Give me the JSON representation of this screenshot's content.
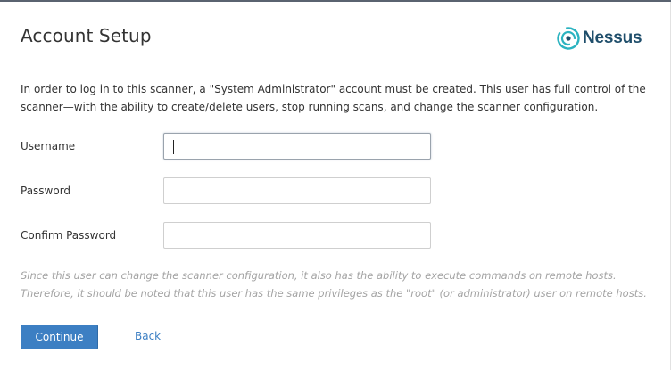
{
  "header": {
    "title": "Account Setup",
    "logo_text": "Nessus",
    "logo_icon": "nessus-logo-icon"
  },
  "intro_text": "In order to log in to this scanner, a \"System Administrator\" account must be created. This user has full control of the scanner—with the ability to create/delete users, stop running scans, and change the scanner configuration.",
  "form": {
    "username": {
      "label": "Username",
      "value": "",
      "focused": true
    },
    "password": {
      "label": "Password",
      "value": ""
    },
    "confirm_password": {
      "label": "Confirm Password",
      "value": ""
    }
  },
  "note_text": "Since this user can change the scanner configuration, it also has the ability to execute commands on remote hosts. Therefore, it should be noted that this user has the same privileges as the \"root\" (or administrator) user on remote hosts.",
  "actions": {
    "continue_label": "Continue",
    "back_label": "Back"
  },
  "colors": {
    "primary": "#3c7fc3",
    "logo_text": "#1f4e6b",
    "logo_accent": "#2bb3c0",
    "note_text": "#a3a3a3"
  }
}
